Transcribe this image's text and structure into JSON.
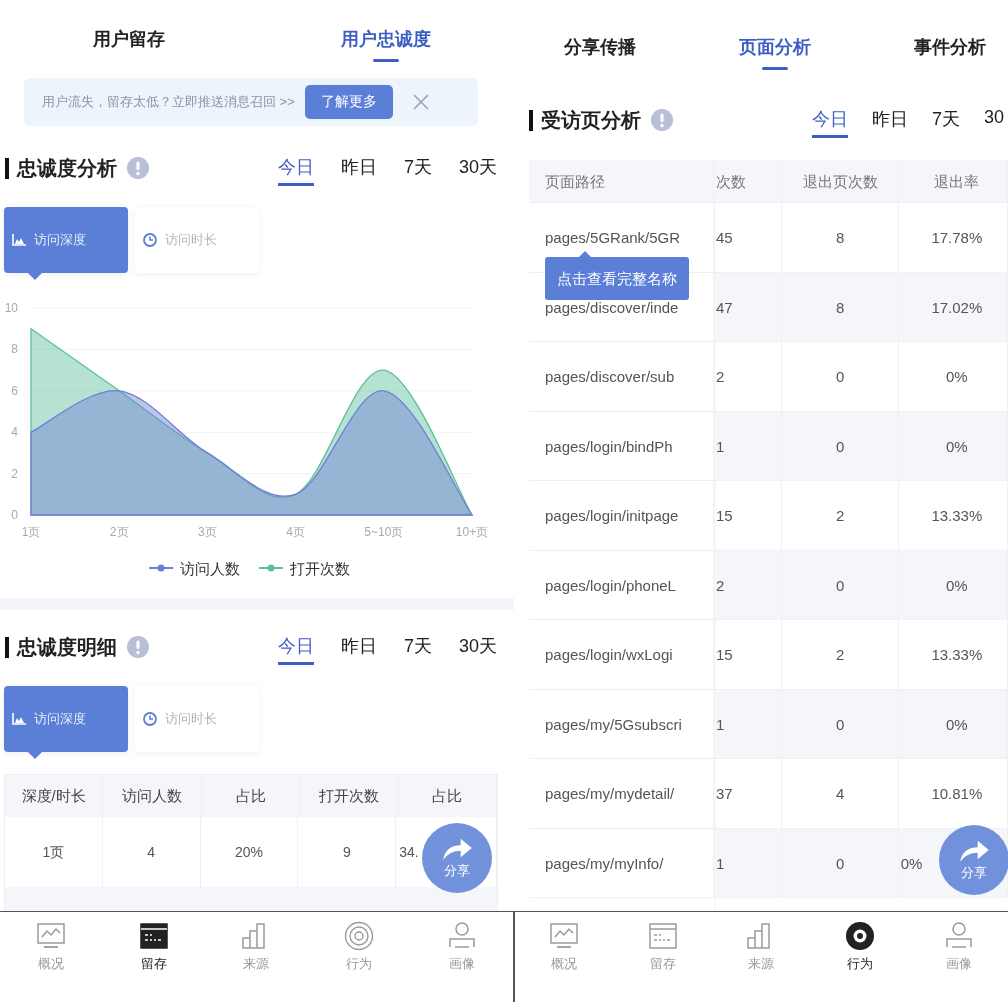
{
  "left_screen": {
    "tabs": [
      {
        "label": "用户留存",
        "selected": false
      },
      {
        "label": "用户忠诚度",
        "selected": true
      }
    ],
    "banner": {
      "text": "用户流失，留存太低？立即推送消息召回 >>",
      "button": "了解更多"
    },
    "loyalty_analysis": {
      "title": "忠诚度分析",
      "periods": [
        {
          "label": "今日",
          "selected": true
        },
        {
          "label": "昨日",
          "selected": false
        },
        {
          "label": "7天",
          "selected": false
        },
        {
          "label": "30天",
          "selected": false
        }
      ],
      "metric_tabs": [
        {
          "kind": "depth",
          "label": "访问深度",
          "selected": true
        },
        {
          "kind": "duration",
          "label": "访问时长",
          "selected": false
        }
      ],
      "chart_data": {
        "type": "area",
        "stacked": false,
        "grid": true,
        "legend": "bottom",
        "categories": [
          "1页",
          "2页",
          "3页",
          "4页",
          "5~10页",
          "10+页"
        ],
        "ylim": [
          0,
          10
        ],
        "yticks": [
          0,
          2,
          4,
          6,
          8,
          10
        ],
        "series": [
          {
            "name": "访问人数",
            "color": "#6f7fd8",
            "values": [
              4,
              6,
              3,
              1,
              6,
              0
            ]
          },
          {
            "name": "打开次数",
            "color": "#5dbf9a",
            "values": [
              9,
              6,
              3,
              1,
              7,
              0
            ]
          }
        ]
      }
    },
    "loyalty_detail": {
      "title": "忠诚度明细",
      "periods": [
        {
          "label": "今日",
          "selected": true
        },
        {
          "label": "昨日",
          "selected": false
        },
        {
          "label": "7天",
          "selected": false
        },
        {
          "label": "30天",
          "selected": false
        }
      ],
      "metric_tabs": [
        {
          "kind": "depth",
          "label": "访问深度",
          "selected": true
        },
        {
          "kind": "duration",
          "label": "访问时长",
          "selected": false
        }
      ],
      "table": {
        "columns": [
          "深度/时长",
          "访问人数",
          "占比",
          "打开次数",
          "占比"
        ],
        "rows": [
          [
            "1页",
            "4",
            "20%",
            "9",
            "34."
          ]
        ]
      }
    },
    "share_button": "分享",
    "nav": [
      {
        "kind": "overview",
        "label": "概况",
        "selected": false
      },
      {
        "kind": "retention",
        "label": "留存",
        "selected": true
      },
      {
        "kind": "source",
        "label": "来源",
        "selected": false
      },
      {
        "kind": "behavior",
        "label": "行为",
        "selected": false
      },
      {
        "kind": "profile",
        "label": "画像",
        "selected": false
      }
    ]
  },
  "right_screen": {
    "tabs": [
      {
        "label": "分享传播",
        "selected": false
      },
      {
        "label": "页面分析",
        "selected": true
      },
      {
        "label": "事件分析",
        "selected": false
      }
    ],
    "visited_pages": {
      "title": "受访页分析",
      "periods": [
        {
          "label": "今日",
          "selected": true
        },
        {
          "label": "昨日",
          "selected": false
        },
        {
          "label": "7天",
          "selected": false
        },
        {
          "label": "30",
          "selected": false
        }
      ],
      "table": {
        "columns": [
          "页面路径",
          "次数",
          "退出页次数",
          "退出率"
        ],
        "rows": [
          [
            "pages/5GRank/5GR",
            "45",
            "8",
            "17.78%"
          ],
          [
            "pages/discover/inde",
            "47",
            "8",
            "17.02%"
          ],
          [
            "pages/discover/sub",
            "2",
            "0",
            "0%"
          ],
          [
            "pages/login/bindPh",
            "1",
            "0",
            "0%"
          ],
          [
            "pages/login/initpage",
            "15",
            "2",
            "13.33%"
          ],
          [
            "pages/login/phoneL",
            "2",
            "0",
            "0%"
          ],
          [
            "pages/login/wxLogi",
            "15",
            "2",
            "13.33%"
          ],
          [
            "pages/my/5Gsubscri",
            "1",
            "0",
            "0%"
          ],
          [
            "pages/my/mydetail/",
            "37",
            "4",
            "10.81%"
          ],
          [
            "pages/my/myInfo/",
            "1",
            "0",
            "0%"
          ]
        ]
      },
      "tooltip": "点击查看完整名称"
    },
    "share_button": "分享",
    "nav": [
      {
        "kind": "overview",
        "label": "概况",
        "selected": false
      },
      {
        "kind": "retention",
        "label": "留存",
        "selected": false
      },
      {
        "kind": "source",
        "label": "来源",
        "selected": false
      },
      {
        "kind": "behavior",
        "label": "行为",
        "selected": true
      },
      {
        "kind": "profile",
        "label": "画像",
        "selected": false
      }
    ]
  }
}
